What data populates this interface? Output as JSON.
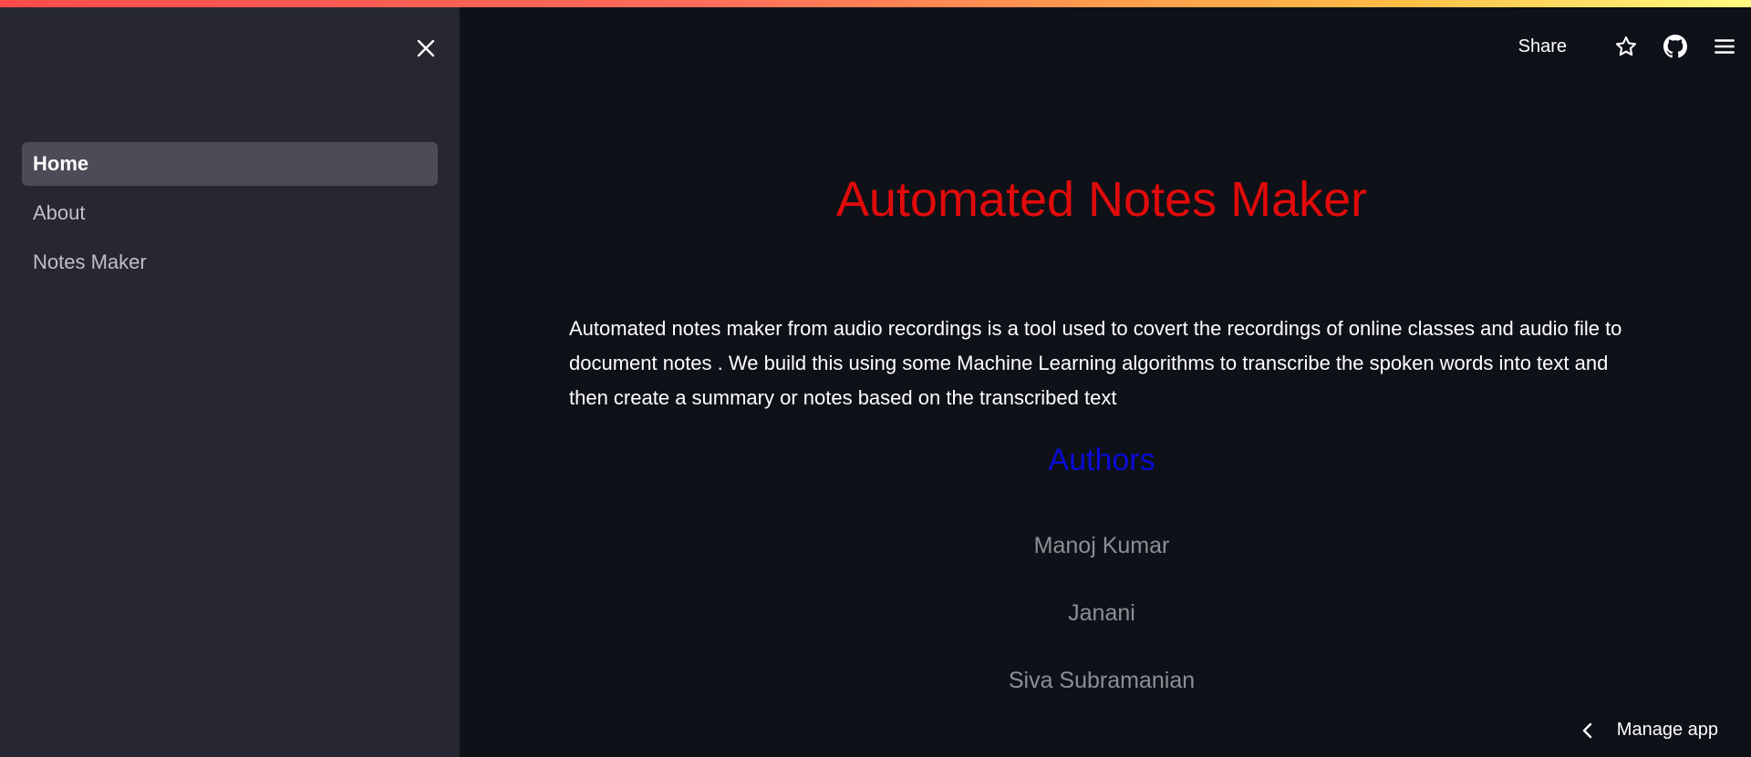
{
  "sidebar": {
    "close_icon": "close-icon",
    "nav": [
      {
        "label": "Home",
        "active": true
      },
      {
        "label": "About",
        "active": false
      },
      {
        "label": "Notes Maker",
        "active": false
      }
    ]
  },
  "header": {
    "share_label": "Share",
    "icons": [
      "star-icon",
      "github-icon",
      "menu-icon"
    ]
  },
  "main": {
    "title": "Automated Notes Maker",
    "description": "Automated notes maker from audio recordings is a tool used to covert the recordings of online classes and audio file to document notes . We build this using some Machine Learning algorithms to transcribe the spoken words into text and then create a summary or notes based on the transcribed text",
    "authors_heading": "Authors",
    "authors": [
      "Manoj Kumar",
      "Janani",
      "Siva Subramanian"
    ]
  },
  "footer": {
    "manage_label": "Manage app"
  },
  "colors": {
    "background": "#0e1117",
    "sidebar": "#262730",
    "title": "#e00b0b",
    "authors_heading": "#0b0bd8",
    "author_name": "#8e8f96"
  }
}
